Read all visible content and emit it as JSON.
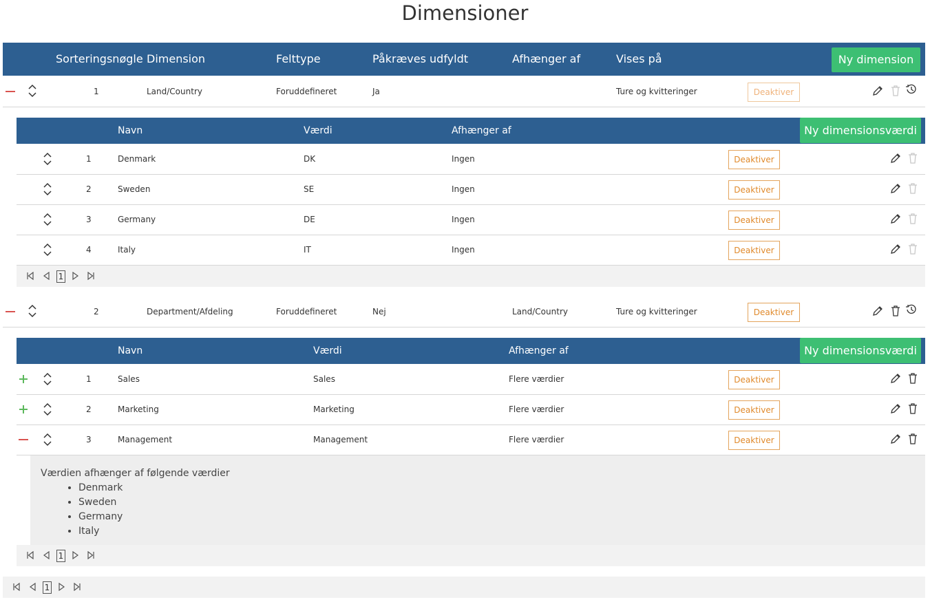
{
  "title": "Dimensioner",
  "main_header": {
    "columns": [
      "Sorteringsnøgle",
      "Dimension",
      "Felttype",
      "Påkræves udfyldt",
      "Afhænger af",
      "Vises på"
    ],
    "new_button": "Ny dimension"
  },
  "dimensions": [
    {
      "sort": "1",
      "name": "Land/Country",
      "field_type": "Foruddefineret",
      "required": "Ja",
      "depends_on": "",
      "shown_on": "Ture og kvitteringer",
      "deactivate": "Deaktiver",
      "expanded": true,
      "values_header": {
        "columns": [
          "Navn",
          "Værdi",
          "Afhænger af"
        ],
        "new_button": "Ny dimensionsværdi"
      },
      "values": [
        {
          "sort": "1",
          "name": "Denmark",
          "value": "DK",
          "depends": "Ingen",
          "deactivate": "Deaktiver"
        },
        {
          "sort": "2",
          "name": "Sweden",
          "value": "SE",
          "depends": "Ingen",
          "deactivate": "Deaktiver"
        },
        {
          "sort": "3",
          "name": "Germany",
          "value": "DE",
          "depends": "Ingen",
          "deactivate": "Deaktiver"
        },
        {
          "sort": "4",
          "name": "Italy",
          "value": "IT",
          "depends": "Ingen",
          "deactivate": "Deaktiver"
        }
      ],
      "pager_page": "1"
    },
    {
      "sort": "2",
      "name": "Department/Afdeling",
      "field_type": "Foruddefineret",
      "required": "Nej",
      "depends_on": "Land/Country",
      "shown_on": "Ture og kvitteringer",
      "deactivate": "Deaktiver",
      "expanded": true,
      "values_header": {
        "columns": [
          "Navn",
          "Værdi",
          "Afhænger af"
        ],
        "new_button": "Ny dimensionsværdi"
      },
      "values": [
        {
          "sort": "1",
          "name": "Sales",
          "value": "Sales",
          "depends": "Flere værdier",
          "deactivate": "Deaktiver",
          "toggle": "expand"
        },
        {
          "sort": "2",
          "name": "Marketing",
          "value": "Marketing",
          "depends": "Flere værdier",
          "deactivate": "Deaktiver",
          "toggle": "expand"
        },
        {
          "sort": "3",
          "name": "Management",
          "value": "Management",
          "depends": "Flere værdier",
          "deactivate": "Deaktiver",
          "toggle": "collapse"
        }
      ],
      "detail": {
        "intro": "Værdien afhænger af følgende værdier",
        "items": [
          "Denmark",
          "Sweden",
          "Germany",
          "Italy"
        ]
      },
      "pager_page": "1"
    }
  ],
  "outer_pager_page": "1",
  "colors": {
    "header_blue": "#2d5f91",
    "green_button": "#3dbf73",
    "deactivate_orange": "#e08a2c",
    "collapse_red": "#d9534f",
    "expand_green": "#5cb85c"
  },
  "icons": [
    "minus-icon",
    "plus-icon",
    "sort-chevrons-icon",
    "pencil-icon",
    "trash-icon",
    "history-icon",
    "pager-first-icon",
    "pager-prev-icon",
    "pager-next-icon",
    "pager-last-icon"
  ]
}
